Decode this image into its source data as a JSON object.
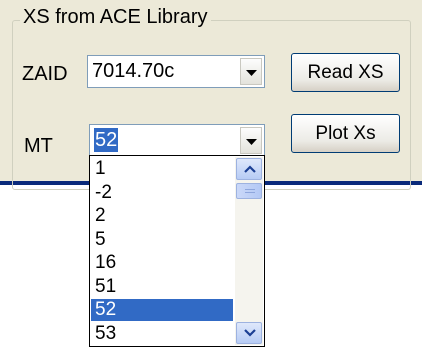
{
  "group": {
    "title": "XS from ACE Library"
  },
  "zaid": {
    "label": "ZAID",
    "value": "7014.70c"
  },
  "mt": {
    "label": "MT",
    "value": "52",
    "options": [
      "1",
      "-2",
      "2",
      "5",
      "16",
      "51",
      "52",
      "53"
    ],
    "selected_index": 6
  },
  "buttons": {
    "read_label": "Read XS",
    "plot_label": "Plot Xs"
  },
  "icons": {
    "dropdown_arrow": "chevron-down-icon",
    "scroll_up": "chevron-up-icon",
    "scroll_down": "chevron-down-icon"
  },
  "colors": {
    "selection": "#316ac5",
    "panel": "#ece9d8",
    "accent_border": "#0a2a7a"
  }
}
